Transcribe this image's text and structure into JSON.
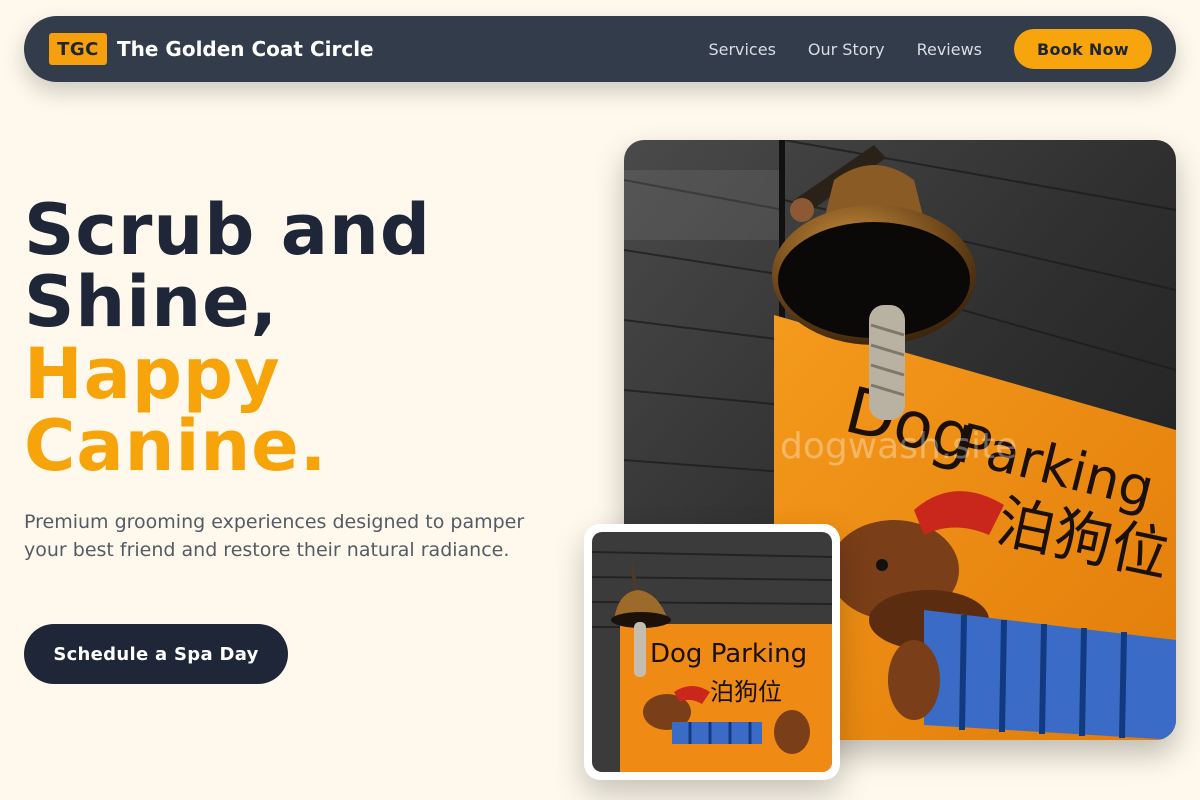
{
  "nav": {
    "logo_badge": "TGC",
    "brand_name": "The Golden Coat Circle",
    "links": [
      "Services",
      "Our Story",
      "Reviews"
    ],
    "book_label": "Book Now"
  },
  "hero": {
    "headline_line1": "Scrub and",
    "headline_line2": "Shine,",
    "headline_accent1": "Happy",
    "headline_accent2": "Canine.",
    "subtext": "Premium grooming experiences designed to pamper your best friend and restore their natural radiance.",
    "cta_label": "Schedule a Spa Day"
  },
  "image": {
    "watermark": "dogwash.site",
    "sign_text": "Dog Parking",
    "sign_chinese": "泊狗位"
  },
  "colors": {
    "background": "#fef9ec",
    "nav": "#323c4b",
    "accent": "#f6a40a",
    "dark": "#1e2638",
    "sign_orange": "#f08a10"
  }
}
